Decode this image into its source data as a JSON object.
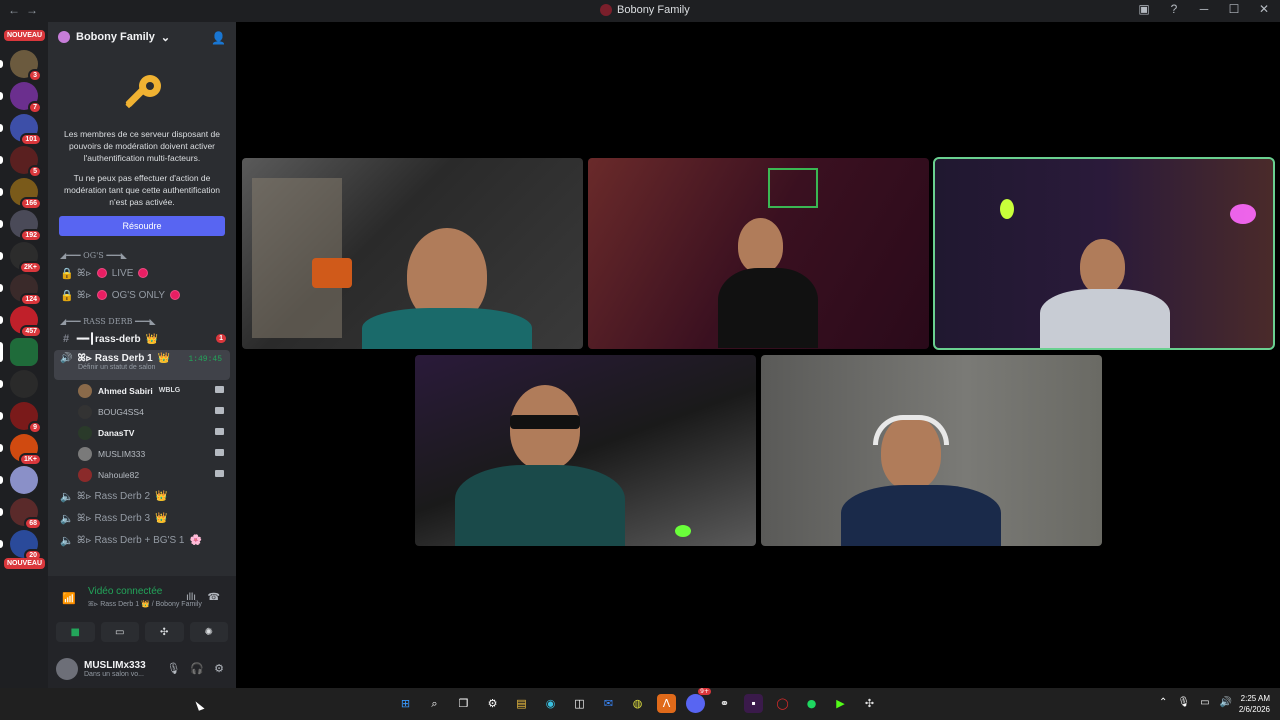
{
  "window": {
    "title": "Bobony Family",
    "nav_back": "←",
    "nav_forward": "→"
  },
  "server_rail": {
    "nouveau_top": "NOUVEAU",
    "nouveau_bottom": "NOUVEAU",
    "badges": [
      "3",
      "7",
      "101",
      "5",
      "166",
      "192",
      "2K+",
      "124",
      "457",
      "9",
      "1K+",
      "68",
      "20"
    ]
  },
  "server": {
    "name": "Bobony Family",
    "chevron": "⌄"
  },
  "mfa_notice": {
    "text1": "Les membres de ce serveur disposant de pouvoirs de modération doivent activer l'authentification multi-facteurs.",
    "text2": "Tu ne peux pas effectuer d'action de modération tant que cette authentification n'est pas activée.",
    "button": "Résoudre"
  },
  "categories": {
    "ogs": "◢━━━ OG'S ━━━◣",
    "rass_derb": "◢━━━ RASS DERB ━━━◣"
  },
  "channels": {
    "live": "ꕤ⊳ ",
    "live_label": "LIVE",
    "ogs_only_label": "OG'S ONLY",
    "rass_derb_text": "━━┃rass-derb",
    "rass_derb_unread": "1",
    "voice1": "ꕤ⊳ Rass Derb 1",
    "voice1_timer": "1:49:45",
    "voice1_status": "Définir un statut de salon",
    "voice2": "ꕤ⊳ Rass Derb 2",
    "voice3": "ꕤ⊳ Rass Derb 3",
    "voice4": "ꕤ⊳ Rass Derb + BG'S 1"
  },
  "members": [
    {
      "name": "Ahmed Sabiri",
      "tag": "WBLG"
    },
    {
      "name": "BOUG4SS4",
      "tag": ""
    },
    {
      "name": "DanasTV",
      "tag": ""
    },
    {
      "name": "MUSLIM333",
      "tag": ""
    },
    {
      "name": "Nahoule82",
      "tag": ""
    }
  ],
  "voice_panel": {
    "status": "Vidéo connectée",
    "location": "ꕤ⊳ Rass Derb 1 👑 / Bobony Family"
  },
  "user_panel": {
    "username": "MUSLIMx333",
    "status": "Dans un salon vo..."
  },
  "taskbar": {
    "time": "2:25 AM",
    "date": "2/6/2026",
    "discord_badge": "9+"
  },
  "colors": {
    "accent": "#5865f2",
    "connected": "#23a55a",
    "danger": "#da373c",
    "speaking_outline": "#6ad090"
  }
}
